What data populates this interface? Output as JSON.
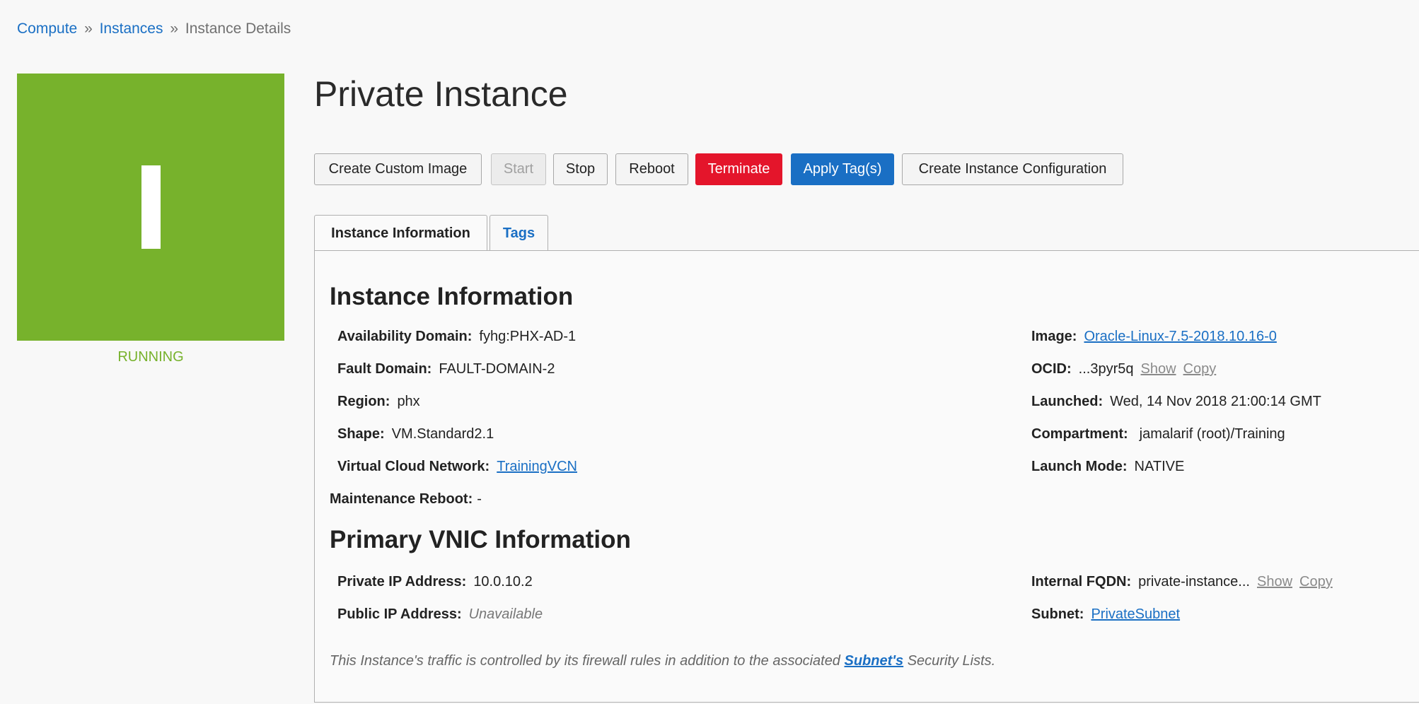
{
  "breadcrumb": {
    "compute": "Compute",
    "sep1": "»",
    "instances": "Instances",
    "sep2": "»",
    "current": "Instance Details"
  },
  "tile": {
    "letter": "I",
    "status": "RUNNING",
    "color": "#77b22c"
  },
  "title": "Private Instance",
  "actions": {
    "create_custom_image": "Create Custom Image",
    "start": "Start",
    "stop": "Stop",
    "reboot": "Reboot",
    "terminate": "Terminate",
    "apply_tags": "Apply Tag(s)",
    "create_instance_config": "Create Instance Configuration"
  },
  "tabs": {
    "instance_info": "Instance Information",
    "tags": "Tags"
  },
  "instance_info": {
    "heading": "Instance Information",
    "availability_domain": {
      "label": "Availability Domain:",
      "value": "fyhg:PHX-AD-1"
    },
    "fault_domain": {
      "label": "Fault Domain:",
      "value": "FAULT-DOMAIN-2"
    },
    "region": {
      "label": "Region:",
      "value": "phx"
    },
    "shape": {
      "label": "Shape:",
      "value": "VM.Standard2.1"
    },
    "vcn": {
      "label": "Virtual Cloud Network:",
      "value": "TrainingVCN"
    },
    "maintenance_reboot": {
      "label": "Maintenance Reboot:",
      "value": "-"
    },
    "image": {
      "label": "Image:",
      "value": "Oracle-Linux-7.5-2018.10.16-0"
    },
    "ocid": {
      "label": "OCID:",
      "value": "...3pyr5q",
      "show": "Show",
      "copy": "Copy"
    },
    "launched": {
      "label": "Launched:",
      "value": "Wed, 14 Nov 2018 21:00:14 GMT"
    },
    "compartment": {
      "label": "Compartment:",
      "value": "jamalarif (root)/Training"
    },
    "launch_mode": {
      "label": "Launch Mode:",
      "value": "NATIVE"
    }
  },
  "vnic": {
    "heading": "Primary VNIC Information",
    "private_ip": {
      "label": "Private IP Address:",
      "value": "10.0.10.2"
    },
    "public_ip": {
      "label": "Public IP Address:",
      "value": "Unavailable"
    },
    "internal_fqdn": {
      "label": "Internal FQDN:",
      "value": "private-instance...",
      "show": "Show",
      "copy": "Copy"
    },
    "subnet": {
      "label": "Subnet:",
      "value": "PrivateSubnet"
    }
  },
  "note": {
    "before": "This Instance's traffic is controlled by its firewall rules in addition to the associated ",
    "link": "Subnet's",
    "after": " Security Lists."
  },
  "colors": {
    "accent": "#1a6fc4",
    "running": "#77b22c",
    "danger": "#e4152b"
  }
}
